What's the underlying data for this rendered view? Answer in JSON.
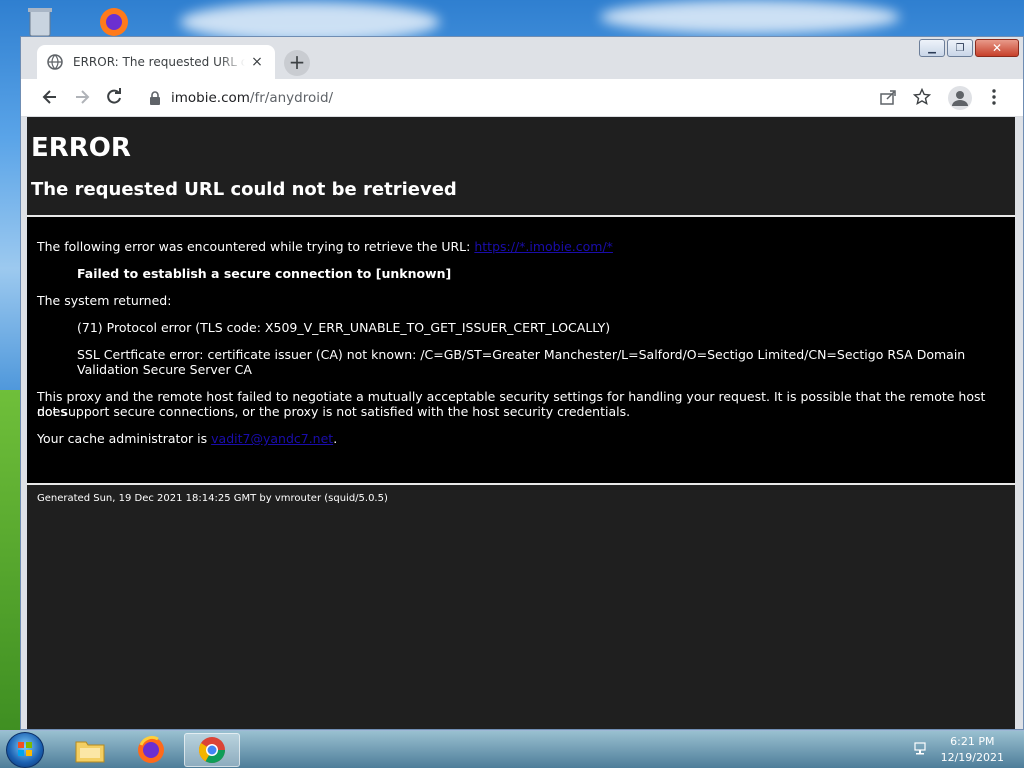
{
  "browser": {
    "tab_title": "ERROR: The requested URL could not be retrieved",
    "tab_close": "×",
    "new_tab": "+",
    "url_host": "imobie.com",
    "url_path": "/fr/anydroid/",
    "window_controls": {
      "minimize": "▁",
      "maximize": "❐",
      "close": "✕"
    }
  },
  "page": {
    "h1": "ERROR",
    "h2": "The requested URL could not be retrieved",
    "intro": "The following error was encountered while trying to retrieve the URL:",
    "intro_link": "https://*.imobie.com/*",
    "failed": "Failed to establish a secure connection to [unknown]",
    "system_returned": "The system returned:",
    "protocol_error": "(71) Protocol error (TLS code: X509_V_ERR_UNABLE_TO_GET_ISSUER_CERT_LOCALLY)",
    "ssl_error_1": "SSL Certficate error: certificate issuer (CA) not known: /C=GB/ST=Greater Manchester/L=Salford/O=Sectigo Limited/CN=Sectigo RSA Domain",
    "ssl_error_2": "Validation Secure Server CA",
    "proxy_1": "This proxy and the remote host failed to negotiate a mutually acceptable security settings for handling your request. It is possible that the remote host does",
    "proxy_2": "not support secure connections, or the proxy is not satisfied with the host security credentials.",
    "admin_prefix": "Your cache administrator is",
    "admin_link": "vadit7@yandc7.net",
    "admin_suffix": ".",
    "footer": "Generated Sun, 19 Dec 2021 18:14:25 GMT by vmrouter (squid/5.0.5)"
  },
  "taskbar": {
    "time": "6:21 PM",
    "date": "12/19/2021"
  },
  "colors": {
    "page_bg": "#1f1f1f",
    "error_box_bg": "#000000",
    "link": "#1a0dab"
  }
}
